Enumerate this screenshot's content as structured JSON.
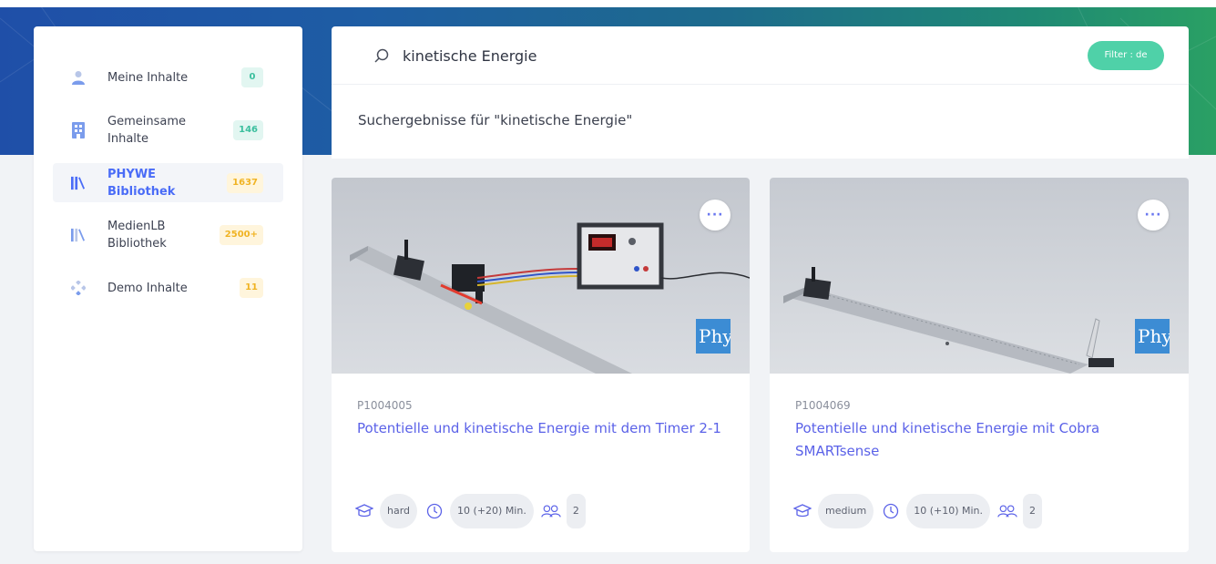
{
  "sidebar": {
    "items": [
      {
        "label": "Meine Inhalte",
        "count": "0",
        "icon": "user-icon"
      },
      {
        "label": "Gemeinsame Inhalte",
        "count": "146",
        "icon": "building-icon"
      },
      {
        "label": "PHYWE Bibliothek",
        "count": "1637",
        "icon": "library-icon",
        "active": true
      },
      {
        "label": "MedienLB Bibliothek",
        "count": "2500+",
        "icon": "library-icon"
      },
      {
        "label": "Demo Inhalte",
        "count": "11",
        "icon": "diamond-grid-icon"
      }
    ]
  },
  "search": {
    "value": "kinetische Energie",
    "filter_label": "Filter : de",
    "results_title": "Suchergebnisse für \"kinetische Energie\""
  },
  "cards": [
    {
      "id": "P1004005",
      "title": "Potentielle und kinetische Energie mit dem Timer 2-1",
      "difficulty": "hard",
      "duration": "10 (+20) Min.",
      "group_size": "2",
      "more_label": "···",
      "logo_text": "Phy"
    },
    {
      "id": "P1004069",
      "title": "Potentielle und kinetische Energie mit Cobra SMARTsense",
      "difficulty": "medium",
      "duration": "10 (+10) Min.",
      "group_size": "2",
      "more_label": "···",
      "logo_text": "Phy"
    }
  ],
  "colors": {
    "accent": "#4a6cf7",
    "link": "#5b62e8",
    "filter": "#4fd1a8",
    "badge_teal": "#3bbf9e",
    "badge_yellow": "#f0b323"
  }
}
